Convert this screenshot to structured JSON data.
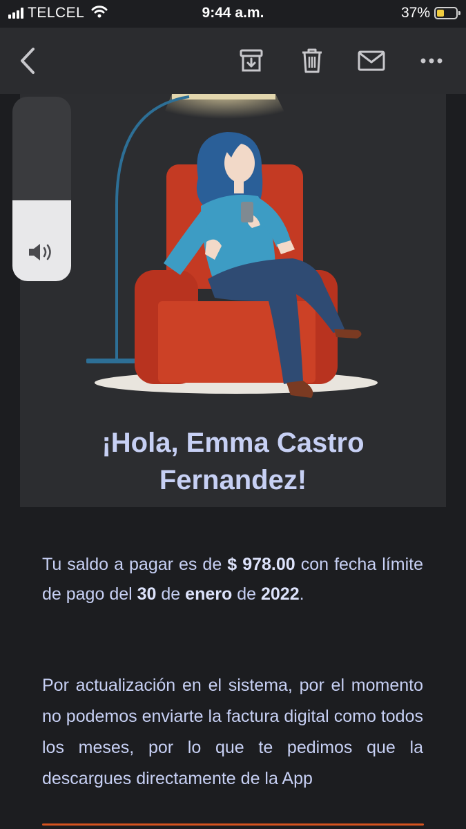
{
  "status_bar": {
    "carrier": "TELCEL",
    "time": "9:44 a.m.",
    "battery_percent": "37%",
    "battery_level": 0.37,
    "icons": [
      "signal-icon",
      "wifi-icon",
      "battery-icon"
    ]
  },
  "toolbar": {
    "icons": [
      "back-chevron-icon",
      "archive-icon",
      "trash-icon",
      "mail-icon",
      "more-icon"
    ]
  },
  "volume": {
    "level": 0.44,
    "icon": "speaker-icon"
  },
  "email": {
    "greeting_line1": "¡Hola, Emma Castro",
    "greeting_line2": "Fernandez!",
    "balance": {
      "prefix": "Tu saldo a pagar es de",
      "amount": "$ 978.00",
      "middle": "con fecha límite de pago del",
      "day": "30",
      "de1": "de",
      "month": "enero",
      "de2": "de",
      "year": "2022",
      "end": "."
    },
    "notice": "Por actualización en el sistema, por el momento no podemos enviarte la factura digital como todos los meses, por lo que te pedimos que la descargues directamente de la App"
  },
  "colors": {
    "background": "#1c1d20",
    "text": "#c7d0f4",
    "accent": "#d5531f",
    "armchair": "#c43a23",
    "shirt": "#3d9cc4",
    "hair": "#2a5f98"
  }
}
